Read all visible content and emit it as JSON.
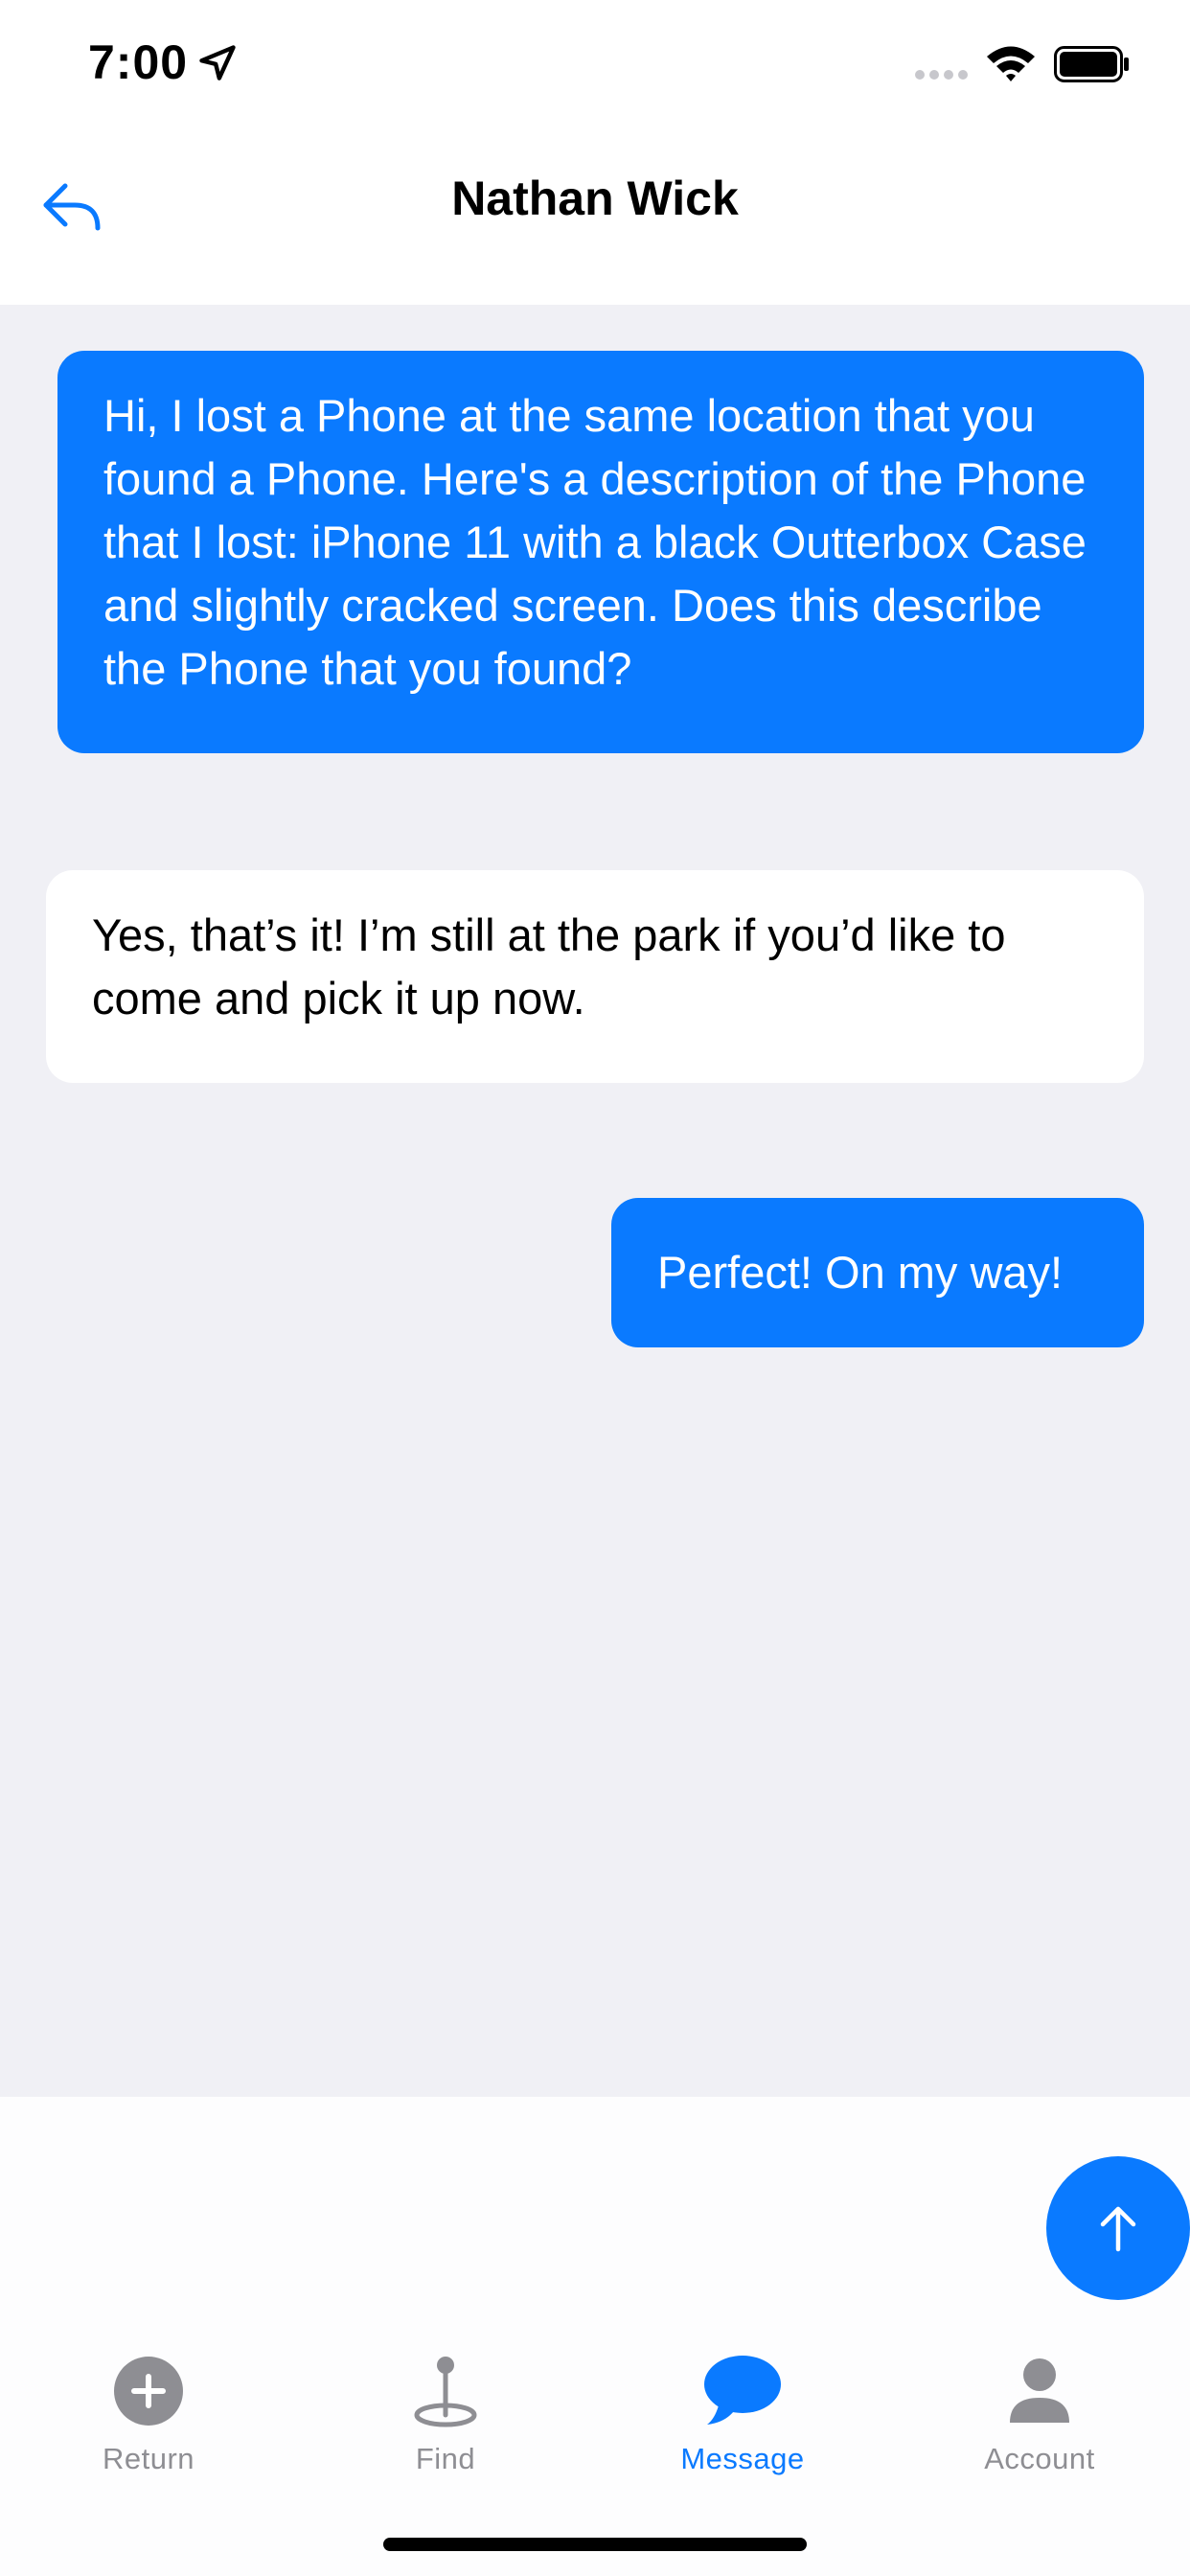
{
  "status_bar": {
    "time": "7:00"
  },
  "nav": {
    "title": "Nathan Wick",
    "back_icon": "reply-arrow-icon"
  },
  "messages": [
    {
      "direction": "outgoing",
      "text": "Hi, I lost a Phone at the same location that you found a Phone. Here's a description of the Phone that I lost: iPhone 11 with a black Outterbox Case and slightly cracked screen. Does this describe the Phone that you found?"
    },
    {
      "direction": "incoming",
      "text": "Yes, that’s it! I’m still at the park if you’d like to come and pick it up now."
    },
    {
      "direction": "outgoing",
      "text": "Perfect! On my way!"
    }
  ],
  "compose": {
    "send_icon": "arrow-up-icon"
  },
  "tabs": [
    {
      "label": "Return",
      "icon": "plus-circle-icon",
      "active": false
    },
    {
      "label": "Find",
      "icon": "map-pin-icon",
      "active": false
    },
    {
      "label": "Message",
      "icon": "chat-bubble-icon",
      "active": true
    },
    {
      "label": "Account",
      "icon": "person-icon",
      "active": false
    }
  ],
  "colors": {
    "accent": "#0a7aff",
    "inactive": "#8e8e93",
    "message_bg": "#f0f0f5"
  }
}
